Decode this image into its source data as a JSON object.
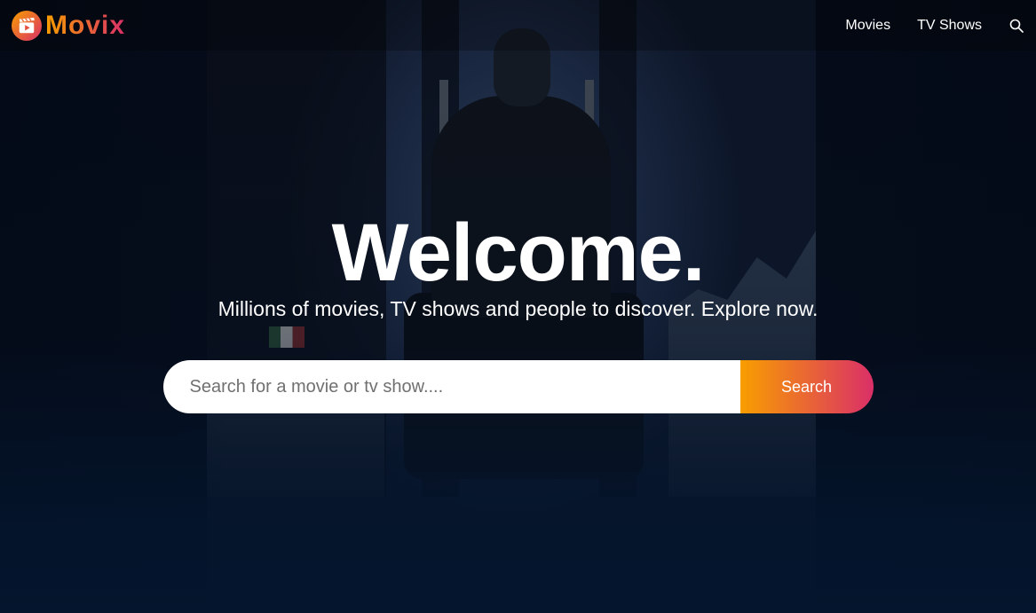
{
  "brand": {
    "name": "Movix",
    "logo_icon": "clapperboard-play-icon",
    "gradient_start": "#f89e00",
    "gradient_end": "#da2f68"
  },
  "nav": {
    "items": [
      {
        "label": "Movies"
      },
      {
        "label": "TV Shows"
      }
    ],
    "search_icon": "search-icon"
  },
  "hero": {
    "title": "Welcome.",
    "subtitle": "Millions of movies, TV shows and people to discover. Explore now.",
    "search": {
      "placeholder": "Search for a movie or tv show....",
      "value": "",
      "button_label": "Search"
    }
  },
  "colors": {
    "background": "#04152d",
    "text": "#ffffff"
  }
}
